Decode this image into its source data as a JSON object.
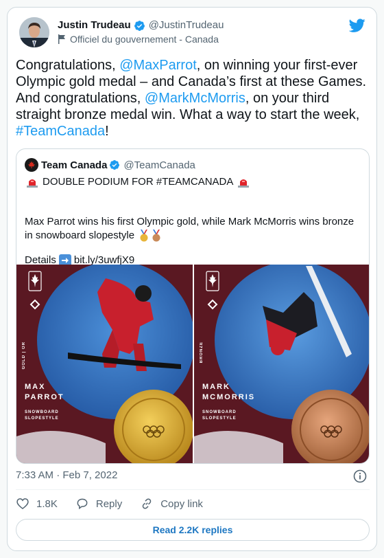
{
  "author": {
    "name": "Justin Trudeau",
    "handle": "@JustinTrudeau",
    "affiliation": "Officiel du gouvernement - Canada"
  },
  "tweet": {
    "t1": "Congratulations, ",
    "m1": "@MaxParrot",
    "t2": ", on winning your first-ever Olympic gold medal – and Canada’s first at these Games. And congratulations, ",
    "m2": "@MarkMcMorris",
    "t3": ", on your third straight bronze medal win. What a way to start the week, ",
    "tag": "#TeamCanada",
    "t4": "!"
  },
  "quote": {
    "name": "Team Canada",
    "handle": "@TeamCanada",
    "headline": "DOUBLE PODIUM FOR #TEAMCANADA",
    "body": "Max Parrot wins his first Olympic gold, while Mark McMorris wins bronze in snowboard slopestyle",
    "details_label": "Details",
    "details_link": "bit.ly/3uwfjX9",
    "images": [
      {
        "name_line1": "MAX",
        "name_line2": "PARROT",
        "sport_line1": "SNOWBOARD",
        "sport_line2": "SLOPESTYLE",
        "medal_word": "GOLD | OR",
        "medal_color": "#d9a92c"
      },
      {
        "name_line1": "MARK",
        "name_line2": "MCMORRIS",
        "sport_line1": "SNOWBOARD",
        "sport_line2": "SLOPESTYLE",
        "medal_word": "BRONZE",
        "medal_color": "#c27a4f"
      }
    ]
  },
  "meta": {
    "timestamp": "7:33 AM · Feb 7, 2022"
  },
  "actions": {
    "likes": "1.8K",
    "reply": "Reply",
    "copy": "Copy link"
  },
  "read_replies": "Read 2.2K replies",
  "colors": {
    "link": "#1d9bf0",
    "verified": "#1d9bf0"
  }
}
